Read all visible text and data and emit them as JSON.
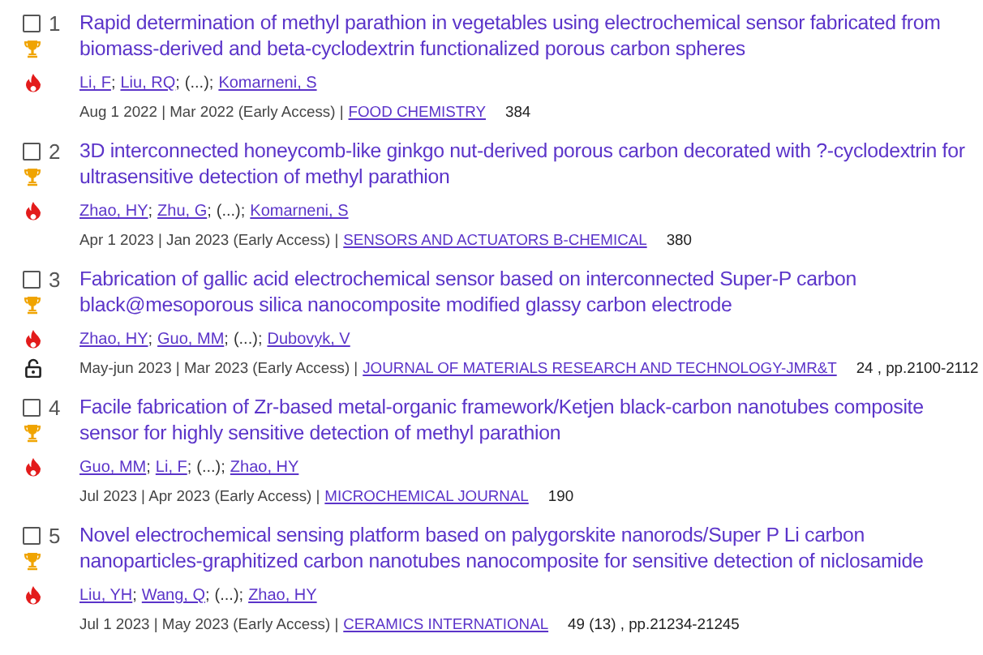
{
  "records": [
    {
      "number": "1",
      "checked": false,
      "title": "Rapid determination of methyl parathion in vegetables using electrochemical sensor fabricated from biomass-derived and beta-cyclodextrin functionalized porous carbon spheres",
      "highly_cited": true,
      "hot_paper": true,
      "open_access": false,
      "authors": [
        {
          "name": "Li, F",
          "kind": "link",
          "sep": ";"
        },
        {
          "name": "Liu, RQ",
          "kind": "link",
          "sep": ";"
        },
        {
          "name": "(...)",
          "kind": "text",
          "sep": ";"
        },
        {
          "name": "Komarneni, S",
          "kind": "link"
        }
      ],
      "dates": "Aug 1 2022 | Mar 2022 (Early Access) |",
      "journal": "FOOD CHEMISTRY",
      "volume": "384"
    },
    {
      "number": "2",
      "checked": false,
      "title": "3D interconnected honeycomb-like ginkgo nut-derived porous carbon decorated with ?-cyclodextrin for ultrasensitive detection of methyl parathion",
      "highly_cited": true,
      "hot_paper": true,
      "open_access": false,
      "authors": [
        {
          "name": "Zhao, HY",
          "kind": "link",
          "sep": ";"
        },
        {
          "name": "Zhu, G",
          "kind": "link",
          "sep": ";"
        },
        {
          "name": "(...)",
          "kind": "text",
          "sep": ";"
        },
        {
          "name": "Komarneni, S",
          "kind": "link"
        }
      ],
      "dates": "Apr 1 2023 | Jan 2023 (Early Access) |",
      "journal": "SENSORS AND ACTUATORS B-CHEMICAL",
      "volume": "380"
    },
    {
      "number": "3",
      "checked": false,
      "title": "Fabrication of gallic acid electrochemical sensor based on interconnected Super-P carbon black@mesoporous silica nanocomposite modified glassy carbon electrode",
      "highly_cited": true,
      "hot_paper": true,
      "open_access": true,
      "authors": [
        {
          "name": "Zhao, HY",
          "kind": "link",
          "sep": ";"
        },
        {
          "name": "Guo, MM",
          "kind": "link",
          "sep": ";"
        },
        {
          "name": "(...)",
          "kind": "text",
          "sep": ";"
        },
        {
          "name": "Dubovyk, V",
          "kind": "link"
        }
      ],
      "dates": "May-jun 2023 | Mar 2023 (Early Access) |",
      "journal": "JOURNAL OF MATERIALS RESEARCH AND TECHNOLOGY-JMR&T",
      "volume": "24 , pp.2100-2112"
    },
    {
      "number": "4",
      "checked": false,
      "title": "Facile fabrication of Zr-based metal-organic framework/Ketjen black-carbon nanotubes composite sensor for highly sensitive detection of methyl parathion",
      "highly_cited": true,
      "hot_paper": true,
      "open_access": false,
      "authors": [
        {
          "name": "Guo, MM",
          "kind": "link",
          "sep": ";"
        },
        {
          "name": "Li, F",
          "kind": "link",
          "sep": ";"
        },
        {
          "name": "(...)",
          "kind": "text",
          "sep": ";"
        },
        {
          "name": "Zhao, HY",
          "kind": "link"
        }
      ],
      "dates": "Jul 2023 | Apr 2023 (Early Access) |",
      "journal": "MICROCHEMICAL JOURNAL",
      "volume": "190"
    },
    {
      "number": "5",
      "checked": false,
      "title": "Novel electrochemical sensing platform based on palygorskite nanorods/Super P Li carbon nanoparticles-graphitized carbon nanotubes nanocomposite for sensitive detection of niclosamide",
      "highly_cited": true,
      "hot_paper": true,
      "open_access": false,
      "authors": [
        {
          "name": "Liu, YH",
          "kind": "link",
          "sep": ";"
        },
        {
          "name": "Wang, Q",
          "kind": "link",
          "sep": ";"
        },
        {
          "name": "(...)",
          "kind": "text",
          "sep": ";"
        },
        {
          "name": "Zhao, HY",
          "kind": "link"
        }
      ],
      "dates": "Jul 1 2023 | May 2023 (Early Access) |",
      "journal": "CERAMICS INTERNATIONAL",
      "volume": "49 (13) , pp.21234-21245"
    }
  ]
}
